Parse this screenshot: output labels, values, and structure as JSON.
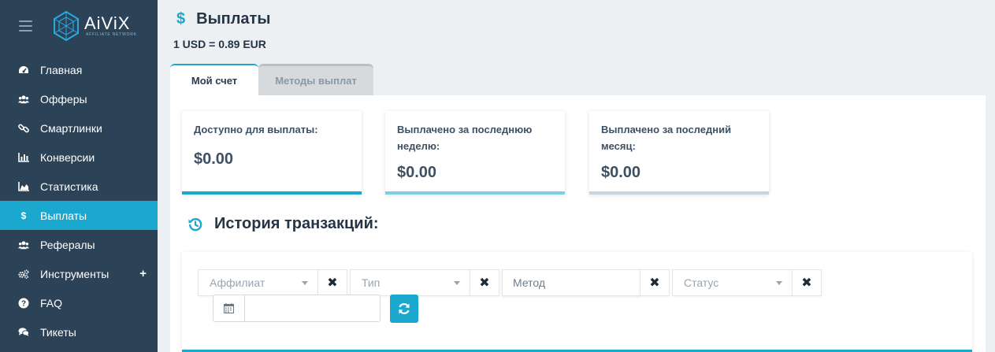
{
  "brand": {
    "name": "AiViX",
    "tagline": "AFFILIATE NETWORK"
  },
  "sidebar": {
    "items": [
      {
        "label": "Главная",
        "icon": "dashboard-icon"
      },
      {
        "label": "Офферы",
        "icon": "users-icon"
      },
      {
        "label": "Смартлинки",
        "icon": "link-icon"
      },
      {
        "label": "Конверсии",
        "icon": "bar-chart-icon"
      },
      {
        "label": "Статистика",
        "icon": "area-chart-icon"
      },
      {
        "label": "Выплаты",
        "icon": "dollar-icon",
        "active": true
      },
      {
        "label": "Рефералы",
        "icon": "users-icon"
      },
      {
        "label": "Инструменты",
        "icon": "cogs-icon",
        "expand": "+"
      },
      {
        "label": "FAQ",
        "icon": "question-icon"
      },
      {
        "label": "Тикеты",
        "icon": "comments-icon"
      }
    ]
  },
  "header": {
    "title_icon": "$",
    "title": "Выплаты",
    "rate": "1 USD = 0.89 EUR"
  },
  "tabs": [
    {
      "label": "Мой счет",
      "active": true
    },
    {
      "label": "Методы выплат",
      "active": false
    }
  ],
  "cards": [
    {
      "label": "Доступно для выплаты:",
      "value": "$0.00"
    },
    {
      "label": "Выплачено за последнюю неделю:",
      "value": "$0.00"
    },
    {
      "label": "Выплачено за последний месяц:",
      "value": "$0.00"
    }
  ],
  "history": {
    "title": "История транзакций:"
  },
  "filters": {
    "affiliate_placeholder": "Аффилиат",
    "type_placeholder": "Тип",
    "method_placeholder": "Метод",
    "status_placeholder": "Статус",
    "clear_symbol": "✖",
    "date_value": ""
  },
  "colors": {
    "sidebar_bg": "#2b4257",
    "accent": "#1aa8cf",
    "page_bg": "#ecf0f3"
  }
}
